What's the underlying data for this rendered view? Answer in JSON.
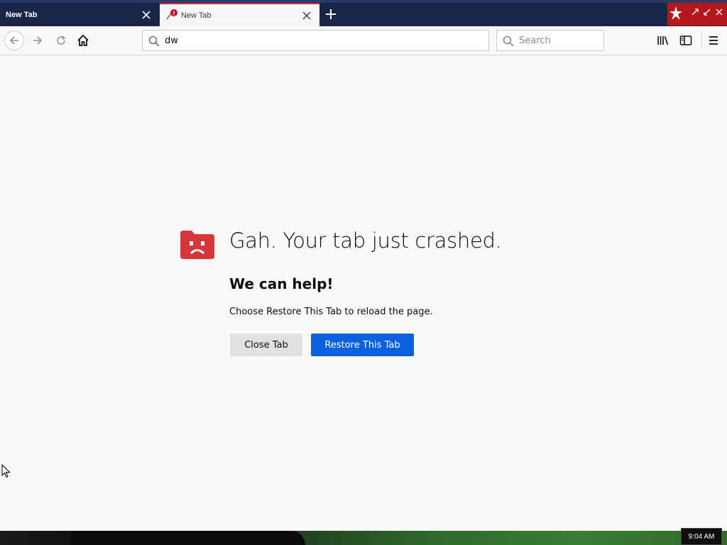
{
  "tabs": [
    {
      "label": "New Tab",
      "active": false
    },
    {
      "label": "New Tab",
      "active": true,
      "badge": "!"
    }
  ],
  "navbar": {
    "url_value": "dw",
    "search_placeholder": "Search"
  },
  "crash": {
    "title": "Gah. Your tab just crashed.",
    "subtitle": "We can help!",
    "message": "Choose Restore This Tab to reload the page.",
    "close_button": "Close Tab",
    "restore_button": "Restore This Tab"
  },
  "taskbar": {
    "clock": "9:04 AM"
  },
  "colors": {
    "tabstrip": "#1a2649",
    "active_tab_accent": "#c0244b",
    "crash_icon": "#d7353a",
    "primary_button": "#0a60df",
    "secondary_button": "#e1e1e3"
  }
}
